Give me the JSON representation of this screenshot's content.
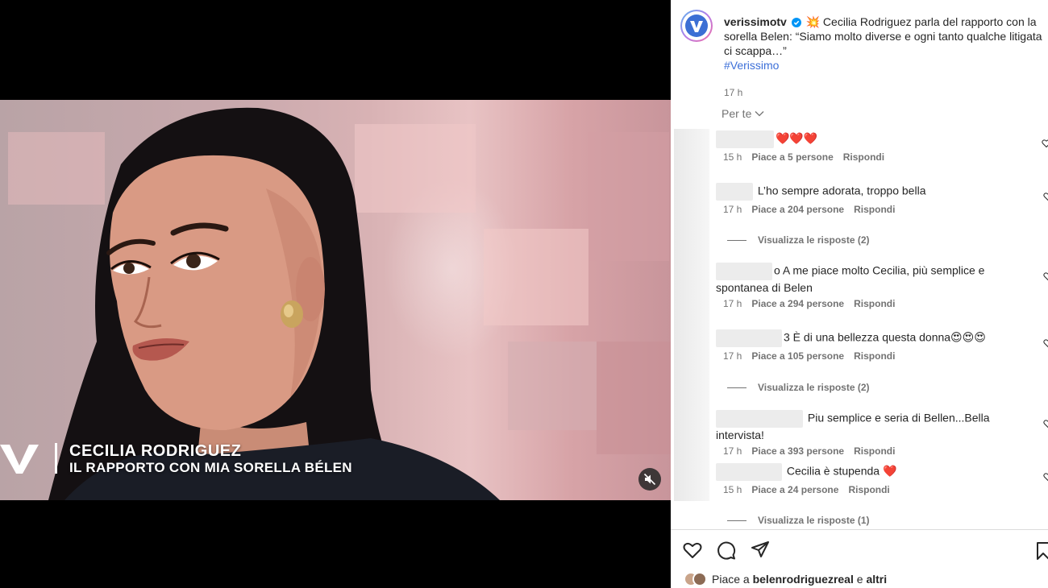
{
  "video": {
    "lower_third_name": "CECILIA RODRIGUEZ",
    "lower_third_sub": "IL RAPPORTO CON MIA SORELLA BÉLEN",
    "mute_icon": "speaker-muted-icon"
  },
  "post": {
    "username": "verissimotv",
    "caption": "💥 Cecilia Rodriguez parla del rapporto con la sorella Belen: “Siamo molto diverse e ogni tanto qualche litigata ci scappa…”",
    "hashtag": "#Verissimo",
    "time": "17 h"
  },
  "comments": {
    "sort_label": "Per te",
    "items": [
      {
        "text": "❤️❤️❤️",
        "time": "15 h",
        "likes": "Piace a 5 persone",
        "reply": "Rispondi"
      },
      {
        "text": "L’ho sempre adorata, troppo bella",
        "time": "17 h",
        "likes": "Piace a 204 persone",
        "reply": "Rispondi",
        "view_replies": "Visualizza le risposte (2)"
      },
      {
        "text": "o A me piace molto Cecilia, più semplice e spontanea di Belen",
        "time": "17 h",
        "likes": "Piace a 294 persone",
        "reply": "Rispondi"
      },
      {
        "text": "3 È di una bellezza questa donna😍😍😍",
        "time": "17 h",
        "likes": "Piace a 105 persone",
        "reply": "Rispondi",
        "view_replies": "Visualizza le risposte (2)"
      },
      {
        "text": "Piu semplice e seria di Bellen...Bella intervista!",
        "time": "17 h",
        "likes": "Piace a 393 persone",
        "reply": "Rispondi"
      },
      {
        "text": "Cecilia è stupenda ❤️",
        "time": "15 h",
        "likes": "Piace a 24 persone",
        "reply": "Rispondi",
        "view_replies": "Visualizza le risposte (1)"
      }
    ]
  },
  "actions": {
    "like_icon": "heart-icon",
    "comment_icon": "comment-icon",
    "share_icon": "share-icon",
    "save_icon": "bookmark-icon"
  },
  "likes_row": {
    "prefix": "Piace a",
    "user": "belenrodriguezreal",
    "connector": "e",
    "others": "altri"
  }
}
